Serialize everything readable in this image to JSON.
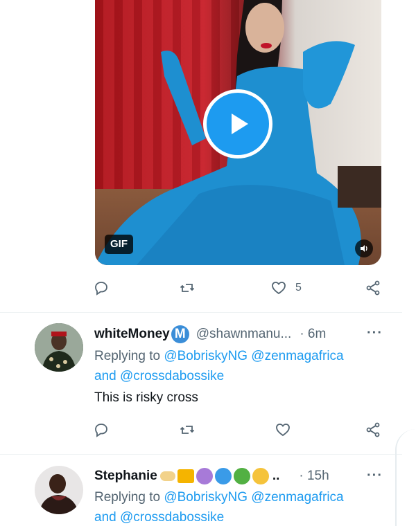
{
  "media": {
    "badge": "GIF",
    "play_icon": "play-icon",
    "mute_icon": "speaker-icon"
  },
  "tweet_actions_1": {
    "like_count": "5"
  },
  "tweet_1": {
    "name": "whiteMoney",
    "verified_badge": "M",
    "handle": "@shawnmanu...",
    "time": "· 6m",
    "more": "···",
    "replying_prefix": "Replying to",
    "mention_1": "@BobriskyNG",
    "mention_2": "@zenmagafrica",
    "and_text": "and",
    "mention_3": "@crossdabossike",
    "text": "This is risky cross"
  },
  "tweet_2": {
    "name": "Stephanie",
    "name_suffix": "..",
    "time": "· 15h",
    "more": "···",
    "replying_prefix": "Replying to",
    "mention_1": "@BobriskyNG",
    "mention_2": "@zenmagafrica",
    "and_text": "and",
    "mention_3": "@crossdabossike"
  },
  "colors": {
    "accent": "#1d9bf0",
    "secondary_text": "#536471",
    "primary_text": "#0f1419"
  }
}
